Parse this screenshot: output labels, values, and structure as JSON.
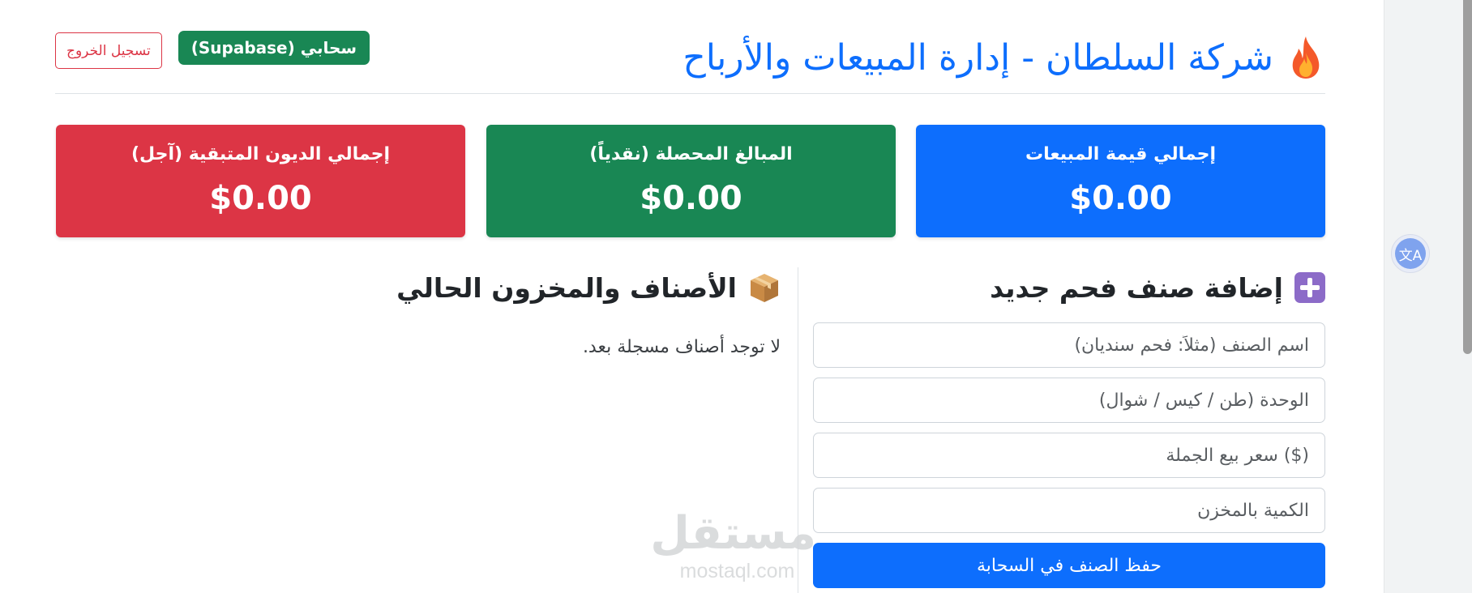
{
  "header": {
    "title": "شركة السلطان - إدارة المبيعات والأرباح",
    "cloud_badge": "سحابي (Supabase)",
    "logout_label": "تسجيل الخروج"
  },
  "stats": {
    "total_sales": {
      "label": "إجمالي قيمة المبيعات",
      "value": "$0.00"
    },
    "collected": {
      "label": "المبالغ المحصلة (نقدياً)",
      "value": "$0.00"
    },
    "debts": {
      "label": "إجمالي الديون المتبقية (آجل)",
      "value": "$0.00"
    }
  },
  "add_form": {
    "title": "إضافة صنف فحم جديد",
    "name_placeholder": "اسم الصنف (مثلاً: فحم سنديان)",
    "unit_placeholder": "الوحدة (طن / كيس / شوال)",
    "price_placeholder": "($) سعر بيع الجملة",
    "qty_placeholder": "الكمية بالمخزن",
    "save_label": "حفظ الصنف في السحابة"
  },
  "inventory": {
    "title": "الأصناف والمخزون الحالي",
    "empty_message": "لا توجد أصناف مسجلة بعد."
  },
  "watermark": {
    "arabic": "مستقل",
    "latin": "mostaql.com"
  },
  "icons": {
    "title_icon": "fire-icon",
    "add_icon": "plus-icon",
    "inventory_icon": "box-icon",
    "translate_icon": "translate-icon"
  },
  "colors": {
    "primary": "#0d6efd",
    "success": "#198754",
    "danger": "#dc3545"
  }
}
